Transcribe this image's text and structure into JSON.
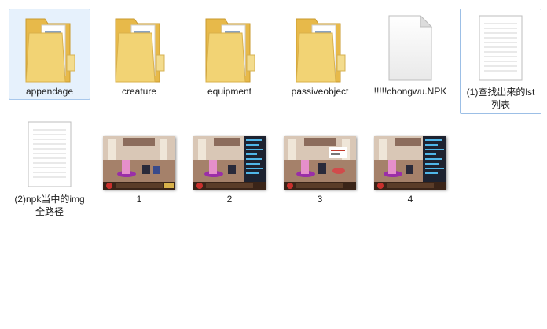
{
  "items": [
    {
      "label": "appendage",
      "type": "folder"
    },
    {
      "label": "creature",
      "type": "folder"
    },
    {
      "label": "equipment",
      "type": "folder"
    },
    {
      "label": "passiveobject",
      "type": "folder"
    },
    {
      "label": "!!!!!chongwu.NPK",
      "type": "file"
    },
    {
      "label": "(1)查找出来的lst列表",
      "type": "text-document"
    },
    {
      "label": "(2)npk当中的img全路径",
      "type": "text-document"
    },
    {
      "label": "1",
      "type": "image"
    },
    {
      "label": "2",
      "type": "image"
    },
    {
      "label": "3",
      "type": "image"
    },
    {
      "label": "4",
      "type": "image"
    }
  ],
  "icons": {
    "folder": "folder-icon",
    "file": "blank-file-icon",
    "text_document": "text-document-icon",
    "image": "image-thumbnail"
  },
  "colors": {
    "selection_fill": "#e6f1fc",
    "selection_border": "#a8c8ec",
    "folder_yellow": "#f2d374"
  }
}
